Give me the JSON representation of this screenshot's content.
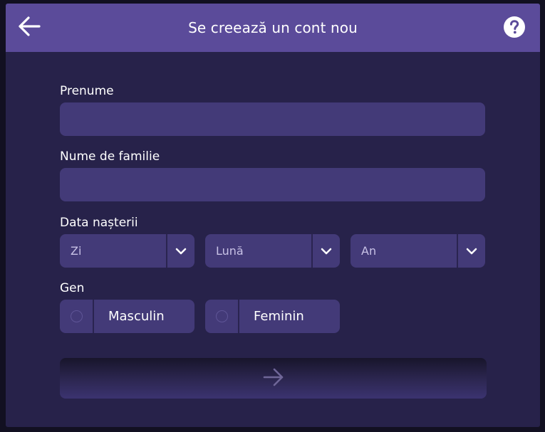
{
  "header": {
    "title": "Se creează un cont nou",
    "back_icon": "arrow-left-icon",
    "help_icon": "question-circle-icon"
  },
  "form": {
    "first_name": {
      "label": "Prenume",
      "value": ""
    },
    "last_name": {
      "label": "Nume de familie",
      "value": ""
    },
    "birth_date": {
      "label": "Data nașterii",
      "day_placeholder": "Zi",
      "month_placeholder": "Lună",
      "year_placeholder": "An"
    },
    "gender": {
      "label": "Gen",
      "options": [
        "Masculin",
        "Feminin"
      ]
    },
    "next_icon": "arrow-right-icon"
  },
  "colors": {
    "header_bg": "#5b4b9a",
    "window_bg": "#27224a",
    "field_bg": "#433a78",
    "text": "#ffffff"
  }
}
